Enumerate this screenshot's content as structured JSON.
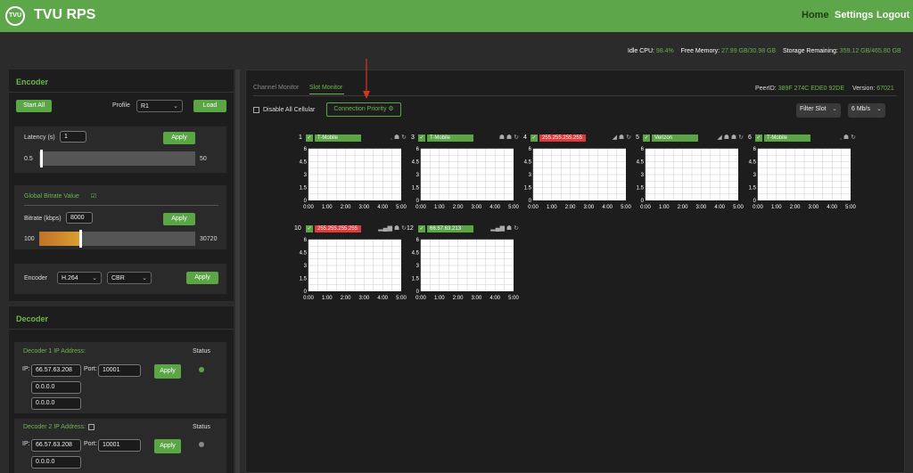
{
  "header": {
    "logo_text": "TVU",
    "title": "TVU RPS",
    "nav": [
      {
        "label": "Home",
        "active": true
      },
      {
        "label": "Settings",
        "active": false
      },
      {
        "label": "Logout",
        "active": false
      }
    ]
  },
  "stats": {
    "cpu_label": "Idle CPU:",
    "cpu_value": "98.4%",
    "mem_label": "Free Memory:",
    "mem_value": "27.99 GB/30.98 GB",
    "storage_label": "Storage Remaining:",
    "storage_value": "359.12 GB/465.80 GB"
  },
  "encoder": {
    "title": "Encoder",
    "start_all": "Start All",
    "profile_label": "Profile",
    "profile_value": "R1",
    "load": "Load",
    "latency_label": "Latency (s)",
    "latency_value": "1",
    "latency_apply": "Apply",
    "latency_min": "0.5",
    "latency_max": "50",
    "latency_level": 0.01,
    "global_bitrate_label": "Global Bitrate Value",
    "bitrate_label": "Bitrate (kbps)",
    "bitrate_value": "8000",
    "bitrate_apply": "Apply",
    "bitrate_min": "100",
    "bitrate_max": "30720",
    "bitrate_level": 0.26,
    "encoder_label": "Encoder",
    "codec_value": "H.264",
    "rate_mode_value": "CBR",
    "encoder_apply": "Apply"
  },
  "decoder": {
    "title": "Decoder",
    "status_label": "Status",
    "items": [
      {
        "label": "Decoder 1 IP Address:",
        "ip_label": "IP:",
        "ip1": "66.57.63.208",
        "ip2": "0.0.0.0",
        "ip3": "0.0.0.0",
        "port_label": "Port:",
        "port": "10001",
        "apply": "Apply",
        "status_color": "#5aa544"
      },
      {
        "label": "Decoder 2 IP Address:",
        "ip_label": "IP:",
        "ip1": "66.57.63.208",
        "ip2": "0.0.0.0",
        "port_label": "Port:",
        "port": "10001",
        "apply": "Apply",
        "status_color": "#888888"
      }
    ]
  },
  "monitor": {
    "tabs": [
      {
        "label": "Channel Monitor",
        "active": false
      },
      {
        "label": "Slot Monitor",
        "active": true
      }
    ],
    "peer_label": "PeerID:",
    "peer_value": "389F 274C EDE0 92DE",
    "version_label": "Version:",
    "version_value": "67021",
    "disable_all": "Disable All Cellular",
    "connection_priority": "Connection Priority",
    "filter_slot": "Filter Slot",
    "rate": "6 Mb/s"
  },
  "chart_data": {
    "type": "line",
    "x": [
      "0:00",
      "1:00",
      "2:00",
      "3:00",
      "4:00",
      "5:00"
    ],
    "yticks": [
      "6",
      "4.5",
      "3",
      "1.5",
      "0"
    ],
    "ylim": [
      0,
      6
    ],
    "slots": [
      {
        "num": "1",
        "name": "T-Mobile",
        "name_color": "#5aa544",
        "icons": ",  ☗ ↻"
      },
      {
        "num": "3",
        "name": "T-Mobile",
        "name_color": "#5aa544",
        "icons": "☗ ☗ ↻"
      },
      {
        "num": "4",
        "name": "255.255.255.255",
        "name_color": "#e03a3a",
        "icons": "◢  ☗ ↻"
      },
      {
        "num": "5",
        "name": "Verizon",
        "name_color": "#5aa544",
        "icons": "◢ ☗ ☗ ↻"
      },
      {
        "num": "6",
        "name": "T-Mobile",
        "name_color": "#5aa544",
        "icons": ", ☗ ↻"
      },
      {
        "num": "10",
        "name": "255.255.255.255",
        "name_color": "#e03a3a",
        "icons": "▂▄▆ ☗ ↻"
      },
      {
        "num": "12",
        "name": "66.57.63.213",
        "name_color": "#5aa544",
        "icons": "▂▄▆ ☗ ↻"
      }
    ]
  }
}
